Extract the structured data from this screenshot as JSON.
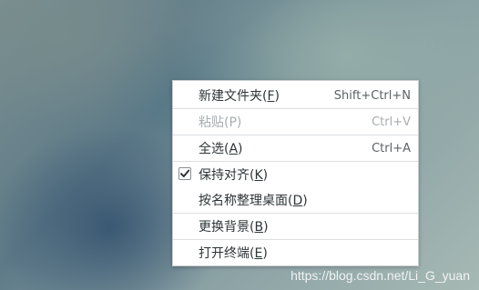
{
  "menu": {
    "items": [
      {
        "label": "新建文件夹(",
        "mnemonic": "F",
        "label_end": ")",
        "shortcut": "Shift+Ctrl+N",
        "enabled": true
      },
      {
        "label": "粘贴(P)",
        "shortcut": "Ctrl+V",
        "enabled": false
      },
      {
        "label": "全选(",
        "mnemonic": "A",
        "label_end": ")",
        "shortcut": "Ctrl+A",
        "enabled": true
      },
      {
        "label": "保持对齐(",
        "mnemonic": "K",
        "label_end": ")",
        "checked": true,
        "enabled": true
      },
      {
        "label": "按名称整理桌面(",
        "mnemonic": "D",
        "label_end": ")",
        "enabled": true
      },
      {
        "label": "更换背景(",
        "mnemonic": "B",
        "label_end": ")",
        "enabled": true
      },
      {
        "label": "打开终端(",
        "mnemonic": "E",
        "label_end": ")",
        "enabled": true
      }
    ]
  },
  "watermark": "https://blog.csdn.net/Li_G_yuan",
  "colors": {
    "menu_background": "#ffffff",
    "text": "#2e3436",
    "disabled_text": "#a9adaf"
  }
}
